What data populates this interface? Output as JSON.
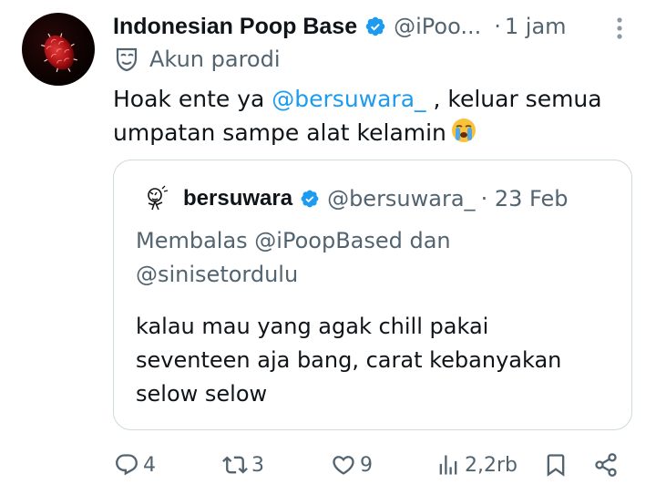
{
  "tweet": {
    "author_name": "Indonesian Poop Base",
    "handle": "@iPoo...",
    "separator": "·",
    "time": "1 jam",
    "parody_label": "Akun parodi",
    "text_part1": "Hoak ente ya ",
    "mention": "@bersuwara_",
    "text_part2": " , keluar semua umpatan sampe alat kelamin",
    "emoji": "loudly-crying-face"
  },
  "quote": {
    "author_name": "bersuwara",
    "handle": "@bersuwara_",
    "date": "· 23 Feb",
    "reply_to": "Membalas @iPoopBased dan @sinisetordulu",
    "text": "kalau mau yang agak chill pakai seventeen aja bang, carat kebanyakan selow selow"
  },
  "actions": {
    "replies": "4",
    "reposts": "3",
    "likes": "9",
    "views": "2,2rb"
  },
  "colors": {
    "accent": "#1d9bf0",
    "secondary_text": "#536471",
    "border": "#cfd9de"
  }
}
